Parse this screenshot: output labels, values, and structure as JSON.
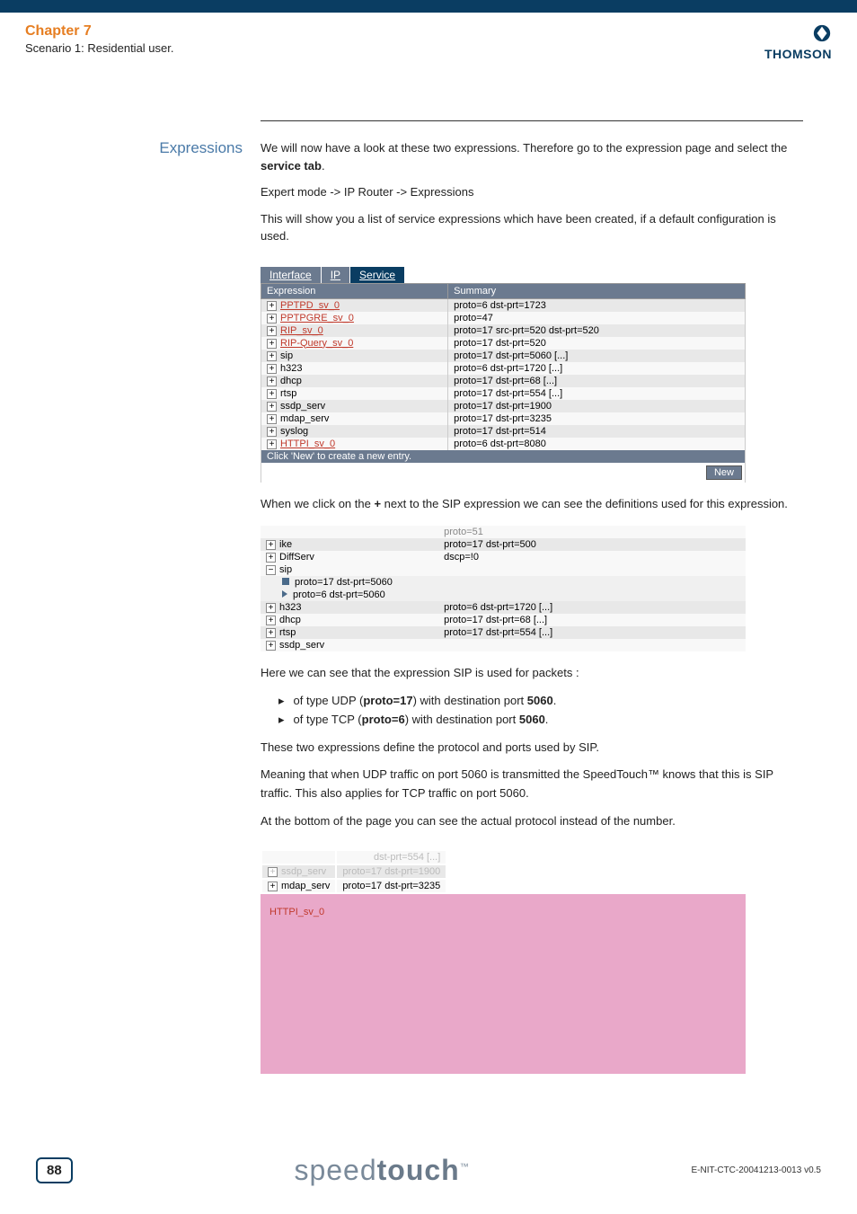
{
  "header": {
    "chapter": "Chapter 7",
    "scenario": "Scenario 1: Residential user.",
    "brand_symbol": "◈",
    "brand": "THOMSON"
  },
  "section": {
    "label": "Expressions",
    "para1_a": "We will now have a look at these two expressions. Therefore go to the expression page and select the ",
    "para1_b": "service tab",
    "para1_c": ".",
    "breadcrumb": "Expert mode -> IP Router -> Expressions",
    "para2": "This will show you a list of service expressions which have been created, if a default configuration is used."
  },
  "tabs": [
    "Interface",
    "IP",
    "Service"
  ],
  "expr_table": {
    "headers": [
      "Expression",
      "Summary"
    ],
    "rows": [
      {
        "name": "PPTPD_sv_0",
        "summary": "proto=6 dst-prt=1723",
        "link": true
      },
      {
        "name": "PPTPGRE_sv_0",
        "summary": "proto=47",
        "link": true
      },
      {
        "name": "RIP_sv_0",
        "summary": "proto=17 src-prt=520 dst-prt=520",
        "link": true
      },
      {
        "name": "RIP-Query_sv_0",
        "summary": "proto=17 dst-prt=520",
        "link": true
      },
      {
        "name": "sip",
        "summary": "proto=17 dst-prt=5060 [...]"
      },
      {
        "name": "h323",
        "summary": "proto=6 dst-prt=1720 [...]"
      },
      {
        "name": "dhcp",
        "summary": "proto=17 dst-prt=68 [...]"
      },
      {
        "name": "rtsp",
        "summary": "proto=17 dst-prt=554 [...]"
      },
      {
        "name": "ssdp_serv",
        "summary": "proto=17 dst-prt=1900"
      },
      {
        "name": "mdap_serv",
        "summary": "proto=17 dst-prt=3235"
      },
      {
        "name": "syslog",
        "summary": "proto=17 dst-prt=514"
      },
      {
        "name": "HTTPI_sv_0",
        "summary": "proto=6 dst-prt=8080",
        "link": true
      }
    ],
    "footer": "Click 'New' to create a new entry.",
    "new_btn": "New"
  },
  "mid_text": {
    "para1_a": "When we click on the ",
    "para1_b": "+",
    "para1_c": " next to the SIP expression we can see the definitions used for this expression."
  },
  "expanded": {
    "top_summary": "proto=51",
    "rows_before": [
      {
        "name": "ike",
        "summary": "proto=17 dst-prt=500"
      },
      {
        "name": "DiffServ",
        "summary": "dscp=!0"
      }
    ],
    "sip_row": {
      "name": "sip",
      "summary": ""
    },
    "sip_details": [
      "proto=17 dst-prt=5060",
      "proto=6 dst-prt=5060"
    ],
    "rows_after": [
      {
        "name": "h323",
        "summary": "proto=6 dst-prt=1720 [...]"
      },
      {
        "name": "dhcp",
        "summary": "proto=17 dst-prt=68 [...]"
      },
      {
        "name": "rtsp",
        "summary": "proto=17 dst-prt=554 [...]"
      },
      {
        "name": "ssdp_serv",
        "summary": ""
      }
    ]
  },
  "explain": {
    "intro": "Here we can see that the expression SIP is used for packets :",
    "bullets": [
      {
        "a": "of type UDP (",
        "b": "proto=17",
        "c": ") with destination port ",
        "d": "5060",
        "e": "."
      },
      {
        "a": "of type TCP (",
        "b": "proto=6",
        "c": ") with destination port ",
        "d": "5060",
        "e": "."
      }
    ],
    "para2": "These two expressions define the protocol and ports used by SIP.",
    "para3": "Meaning that when UDP traffic on port 5060 is transmitted the SpeedTouch™ knows that this is SIP traffic. This also applies for TCP traffic on port 5060.",
    "para4": "At the bottom of the page you can see the actual protocol instead of the number."
  },
  "pink": {
    "faded_top": "dst-prt=554 [...]",
    "rows": [
      {
        "name": "ssdp_serv",
        "summary": "proto=17 dst-prt=1900"
      },
      {
        "name": "mdap_serv",
        "summary": "proto=17 dst-prt=3235"
      }
    ],
    "httpi": "HTTPI_sv_0"
  },
  "footer": {
    "page": "88",
    "product_a": "speed",
    "product_b": "touch",
    "tm": "™",
    "docid": "E-NIT-CTC-20041213-0013 v0.5"
  }
}
